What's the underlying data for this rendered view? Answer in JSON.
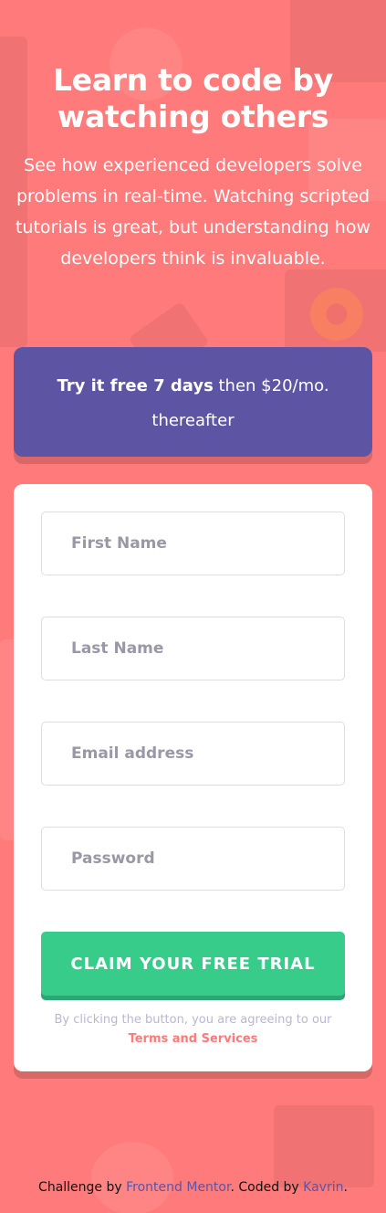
{
  "hero": {
    "title": "Learn to code by watching others",
    "description": "See how experienced developers solve problems in real-time. Watching scripted tutorials is great, but understanding how developers think is invaluable."
  },
  "offer": {
    "bold": "Try it free 7 days",
    "rest": " then $20/mo. thereafter"
  },
  "form": {
    "first_name_placeholder": "First Name",
    "last_name_placeholder": "Last Name",
    "email_placeholder": "Email address",
    "password_placeholder": "Password",
    "submit_label": "CLAIM YOUR FREE TRIAL",
    "terms_text": "By clicking the button, you are agreeing to our",
    "terms_link": "Terms and Services"
  },
  "footer": {
    "prefix": "Challenge by ",
    "fm_link": "Frontend Mentor",
    "middle": ". Coded by ",
    "author_link": "Kavrin",
    "suffix": "."
  },
  "colors": {
    "background": "#ff7a7a",
    "offer": "#5e54a4",
    "cta": "#38cc8b",
    "terms_link": "#ff7a7a"
  }
}
